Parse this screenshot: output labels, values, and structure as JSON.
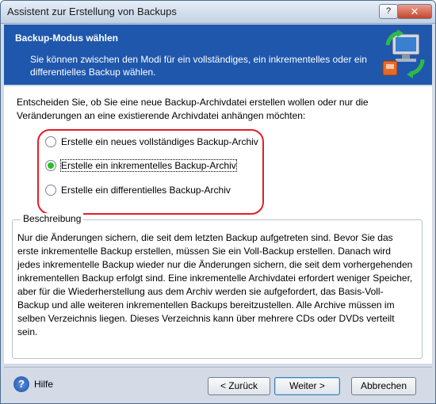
{
  "window": {
    "title": "Assistent zur Erstellung von Backups",
    "help_button": "?",
    "close_button": "✕"
  },
  "banner": {
    "heading": "Backup-Modus wählen",
    "description": "Sie können zwischen den Modi für ein vollständiges, ein inkrementelles oder ein differentielles Backup wählen.",
    "icon": "computer-backup-icon"
  },
  "main": {
    "intro": "Entscheiden Sie, ob Sie eine neue Backup-Archivdatei erstellen wollen oder nur die Veränderungen an eine existierende Archivdatei anhängen möchten:",
    "options": [
      {
        "label": "Erstelle ein neues vollständiges Backup-Archiv",
        "checked": false
      },
      {
        "label": "Erstelle ein inkrementelles Backup-Archiv",
        "checked": true
      },
      {
        "label": "Erstelle ein differentielles Backup-Archiv",
        "checked": false
      }
    ],
    "highlight_color": "#e41e25",
    "description_title": "Beschreibung",
    "description_text": "Nur die Änderungen sichern, die seit dem letzten Backup aufgetreten sind. Bevor Sie das erste inkrementelle Backup erstellen, müssen Sie ein Voll-Backup erstellen. Danach wird jedes inkrementelle Backup wieder nur die Änderungen sichern, die seit dem vorhergehenden inkrementellen Backup erfolgt sind. Eine inkrementelle Archivdatei erfordert weniger Speicher, aber für die Wiederherstellung aus dem Archiv werden sie aufgefordert, das Basis-Voll-Backup und alle weiteren inkrementellen Backups bereitzustellen. Alle Archive müssen im selben Verzeichnis liegen. Dieses Verzeichnis kann über mehrere CDs oder DVDs verteilt sein."
  },
  "footer": {
    "help_label": "Hilfe",
    "back_label": "< Zurück",
    "next_label": "Weiter >",
    "cancel_label": "Abbrechen"
  }
}
